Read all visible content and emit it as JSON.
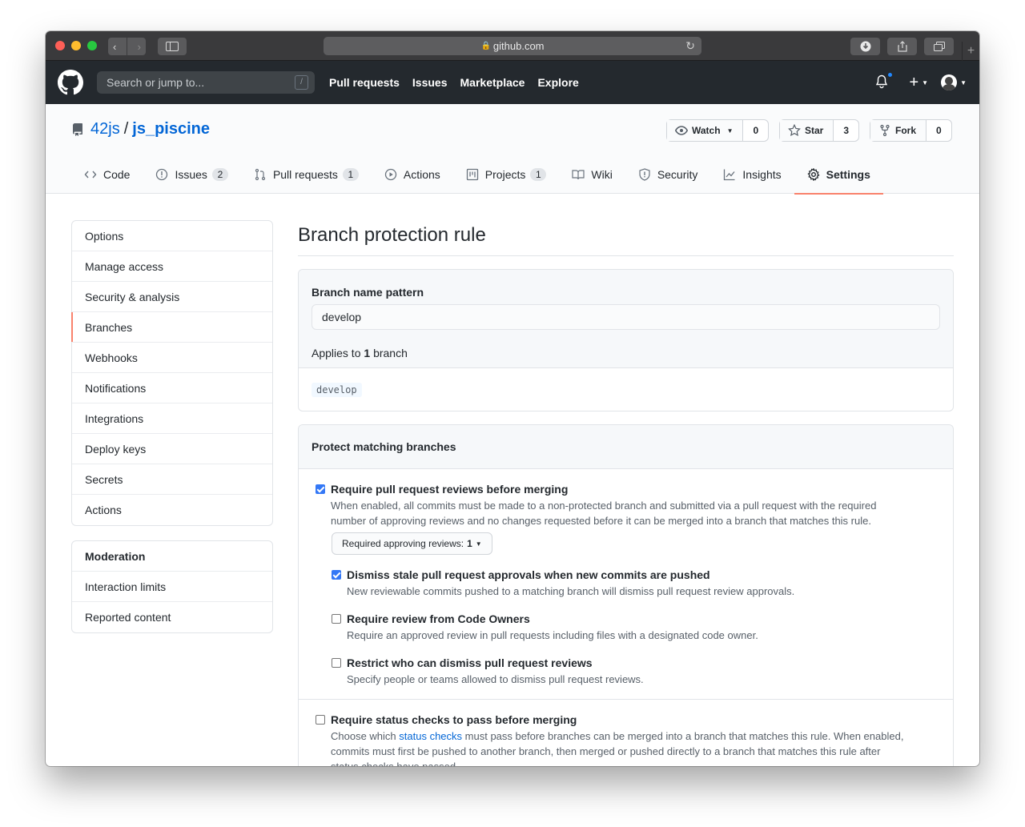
{
  "browser": {
    "url": "github.com"
  },
  "header": {
    "search_placeholder": "Search or jump to...",
    "search_shortcut": "/",
    "nav": [
      "Pull requests",
      "Issues",
      "Marketplace",
      "Explore"
    ]
  },
  "repo": {
    "owner": "42js",
    "separator": "/",
    "name": "js_piscine",
    "watch_label": "Watch",
    "watch_count": "0",
    "star_label": "Star",
    "star_count": "3",
    "fork_label": "Fork",
    "fork_count": "0"
  },
  "tabs": [
    {
      "label": "Code",
      "icon": "code-icon"
    },
    {
      "label": "Issues",
      "icon": "issue-icon",
      "count": "2"
    },
    {
      "label": "Pull requests",
      "icon": "pull-request-icon",
      "count": "1"
    },
    {
      "label": "Actions",
      "icon": "play-icon"
    },
    {
      "label": "Projects",
      "icon": "project-icon",
      "count": "1"
    },
    {
      "label": "Wiki",
      "icon": "book-icon"
    },
    {
      "label": "Security",
      "icon": "shield-icon"
    },
    {
      "label": "Insights",
      "icon": "graph-icon"
    },
    {
      "label": "Settings",
      "icon": "gear-icon",
      "selected": true
    }
  ],
  "sidebar": {
    "items": [
      "Options",
      "Manage access",
      "Security & analysis",
      "Branches",
      "Webhooks",
      "Notifications",
      "Integrations",
      "Deploy keys",
      "Secrets",
      "Actions"
    ],
    "selected": "Branches",
    "moderation_heading": "Moderation",
    "moderation_items": [
      "Interaction limits",
      "Reported content"
    ]
  },
  "main": {
    "title": "Branch protection rule",
    "pattern_label": "Branch name pattern",
    "pattern_value": "develop",
    "applies_prefix": "Applies to",
    "applies_count": "1",
    "applies_suffix": "branch",
    "matched_branch": "develop",
    "protect_heading": "Protect matching branches",
    "options": {
      "require_reviews": {
        "title": "Require pull request reviews before merging",
        "note_line1": "When enabled, all commits must be made to a non-protected branch and submitted via a pull request with the required",
        "note_line2": "number of approving reviews and no changes requested before it can be merged into a branch that matches this rule.",
        "checked": true
      },
      "approving_reviews_label": "Required approving reviews:",
      "approving_reviews_value": "1",
      "dismiss_stale": {
        "title": "Dismiss stale pull request approvals when new commits are pushed",
        "note": "New reviewable commits pushed to a matching branch will dismiss pull request review approvals.",
        "checked": true
      },
      "code_owners": {
        "title": "Require review from Code Owners",
        "note": "Require an approved review in pull requests including files with a designated code owner.",
        "checked": false
      },
      "restrict_dismiss": {
        "title": "Restrict who can dismiss pull request reviews",
        "note": "Specify people or teams allowed to dismiss pull request reviews.",
        "checked": false
      },
      "status_checks": {
        "title": "Require status checks to pass before merging",
        "note_prefix": "Choose which",
        "note_link": "status checks",
        "note_line1_rest": "must pass before branches can be merged into a branch that matches this rule. When enabled,",
        "note_line2": "commits must first be pushed to another branch, then merged or pushed directly to a branch that matches this rule after",
        "note_line3": "status checks have passed.",
        "checked": false
      }
    }
  },
  "colors": {
    "accent_tab": "#f9826c",
    "link": "#0366d6",
    "checkbox": "#3478f6",
    "header_bg": "#24292e"
  }
}
